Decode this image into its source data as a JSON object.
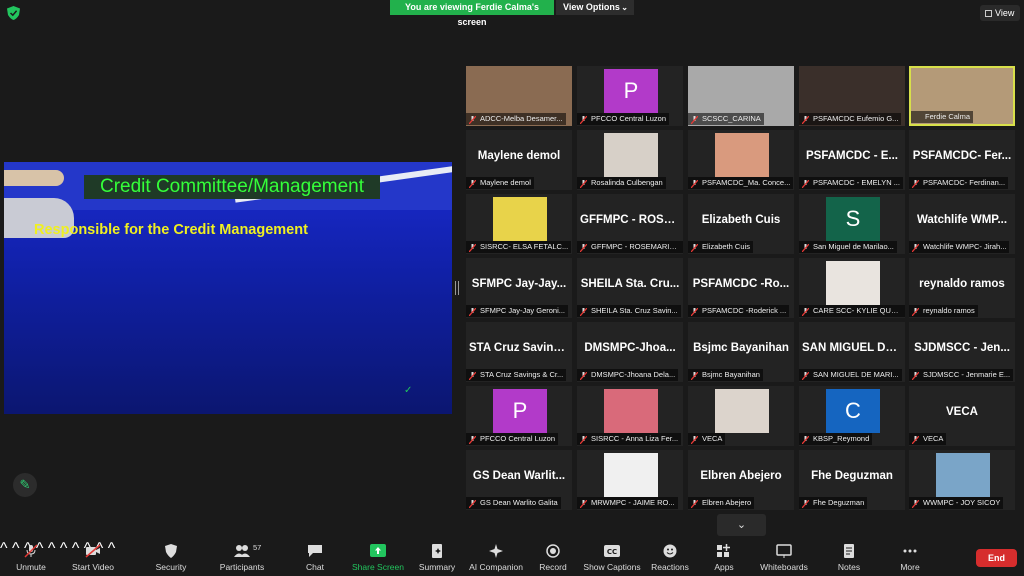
{
  "top": {
    "banner": "You are viewing Ferdie Calma's screen",
    "view_options": "View Options",
    "view_button": "View"
  },
  "shared_screen": {
    "title": "Credit Committee/Management",
    "subtitle": "Responsible for the Credit Management"
  },
  "participants": [
    {
      "label": "ADCC-Melba Desamer...",
      "display": "photo",
      "photo_color": "#8a6b52"
    },
    {
      "label": "PFCCO Central Luzon",
      "display": "letter",
      "letter": "P",
      "color": "#b23ac9"
    },
    {
      "label": "SCSCC_CARINA",
      "display": "photo",
      "photo_color": "#a9a9a9"
    },
    {
      "label": "PSFAMCDC Eufemio G...",
      "display": "photo",
      "photo_color": "#3a2f2a"
    },
    {
      "label": "Ferdie Calma",
      "display": "photo",
      "photo_color": "#b49a78",
      "active": true
    },
    {
      "label": "Maylene demol",
      "display": "name",
      "big": "Maylene demol"
    },
    {
      "label": "Rosalinda Culbengan",
      "display": "photo",
      "photo_color": "#d7d0c8"
    },
    {
      "label": "PSFAMCDC_Ma. Conce...",
      "display": "photo",
      "photo_color": "#d99a7e"
    },
    {
      "label": "PSFAMCDC - EMELYN ...",
      "display": "name",
      "big": "PSFAMCDC - E..."
    },
    {
      "label": "PSFAMCDC- Ferdinan...",
      "display": "name",
      "big": "PSFAMCDC- Fer..."
    },
    {
      "label": "SISRCC- ELSA FETALC...",
      "display": "photo",
      "photo_color": "#e8d34a"
    },
    {
      "label": "GFFMPC - ROSEMARIE...",
      "display": "name",
      "big": "GFFMPC - ROSE..."
    },
    {
      "label": "Elizabeth Cuis",
      "display": "name",
      "big": "Elizabeth Cuis"
    },
    {
      "label": "San Miguel de Marilao...",
      "display": "letter",
      "letter": "S",
      "color": "#13644a"
    },
    {
      "label": "Watchlife WMPC- Jirah...",
      "display": "name",
      "big": "Watchlife WMP..."
    },
    {
      "label": "SFMPC Jay-Jay Geroni...",
      "display": "name",
      "big": "SFMPC Jay-Jay..."
    },
    {
      "label": "SHEILA Sta. Cruz Savin...",
      "display": "name",
      "big": "SHEILA Sta. Cru..."
    },
    {
      "label": "PSFAMCDC -Roderick ...",
      "display": "name",
      "big": "PSFAMCDC -Ro..."
    },
    {
      "label": "CARE SCC- KYLIE QUE...",
      "display": "photo",
      "photo_color": "#e9e4df"
    },
    {
      "label": "reynaldo ramos",
      "display": "name",
      "big": "reynaldo ramos"
    },
    {
      "label": "STA Cruz Savings & Cr...",
      "display": "name",
      "big": "STA Cruz Saving..."
    },
    {
      "label": "DMSMPC-Jhoana Dela...",
      "display": "name",
      "big": "DMSMPC-Jhoa..."
    },
    {
      "label": "Bsjmc Bayanihan",
      "display": "name",
      "big": "Bsjmc Bayanihan"
    },
    {
      "label": "SAN MIGUEL DE MARI...",
      "display": "name",
      "big": "SAN MIGUEL DE..."
    },
    {
      "label": "SJDMSCC - Jenmarie E...",
      "display": "name",
      "big": "SJDMSCC - Jen..."
    },
    {
      "label": "PFCCO Central Luzon",
      "display": "letter",
      "letter": "P",
      "color": "#b23ac9"
    },
    {
      "label": "SISRCC - Anna Liza Fer...",
      "display": "photo",
      "photo_color": "#d96a7a"
    },
    {
      "label": "VECA",
      "display": "photo",
      "photo_color": "#dcd4cc"
    },
    {
      "label": "KBSP_Reymond",
      "display": "letter",
      "letter": "C",
      "color": "#1565c0"
    },
    {
      "label": "VECA",
      "display": "name",
      "big": "VECA"
    },
    {
      "label": "GS Dean Warlito Galita",
      "display": "name",
      "big": "GS Dean Warlit..."
    },
    {
      "label": "MRWMPC - JAIME RO...",
      "display": "photo",
      "photo_color": "#f0f0f0"
    },
    {
      "label": "Elbren Abejero",
      "display": "name",
      "big": "Elbren Abejero"
    },
    {
      "label": "Fhe Deguzman",
      "display": "name",
      "big": "Fhe Deguzman"
    },
    {
      "label": "WWMPC - JOY SICOY",
      "display": "photo",
      "photo_color": "#7aa5c8"
    }
  ],
  "toolbar": {
    "unmute": "Unmute",
    "start_video": "Start Video",
    "security": "Security",
    "participants": "Participants",
    "participants_count": "57",
    "chat": "Chat",
    "share_screen": "Share Screen",
    "summary": "Summary",
    "ai_companion": "AI Companion",
    "record": "Record",
    "show_captions": "Show Captions",
    "reactions": "Reactions",
    "apps": "Apps",
    "whiteboards": "Whiteboards",
    "notes": "Notes",
    "more": "More",
    "end": "End"
  }
}
